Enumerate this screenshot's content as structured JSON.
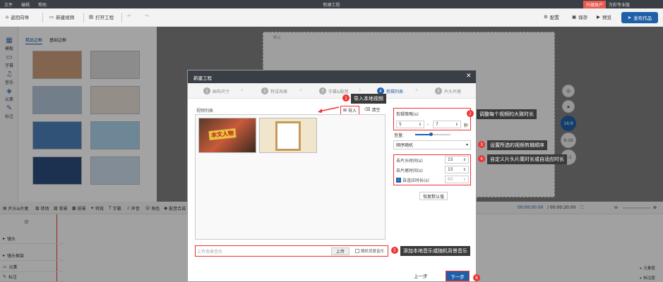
{
  "titlebar": {
    "menu": [
      "文件",
      "编辑",
      "帮助"
    ],
    "window_title": "新建工程",
    "vip": "升级账户",
    "account": "万彩专业版"
  },
  "toolbar": {
    "wizard": "返回向导",
    "new_video": "新建视频",
    "open_project": "打开工程",
    "settings": "配置",
    "save": "保存",
    "preview": "预览",
    "publish": "发布作品"
  },
  "leftnav": {
    "items": [
      "模板",
      "字幕",
      "音乐",
      "元素",
      "标注"
    ]
  },
  "panel": {
    "tab_active": "精品边框",
    "tab_other": "基础边框"
  },
  "canvas": {
    "label": "默认"
  },
  "aspect": [
    "16:9",
    "9:16",
    "1:1"
  ],
  "timeline_toolbar": [
    "片头&片尾",
    "转场",
    "背景",
    "前景",
    "特效",
    "字幕",
    "声音",
    "角色",
    "配音合成"
  ],
  "timeline": {
    "current_time": "00:00:00.00",
    "total_time": "/ 00:00:20.00",
    "tracks": [
      "镜头",
      "镜头框架",
      "元素",
      "标注"
    ],
    "add_element": "+ 元素层",
    "add_note": "+ 标注层"
  },
  "dialog": {
    "title": "新建工程",
    "steps": [
      {
        "num": "1",
        "label": "画布尺寸"
      },
      {
        "num": "2",
        "label": "特设风格"
      },
      {
        "num": "3",
        "label": "字幕&配音"
      },
      {
        "num": "4",
        "label": "剪辑列表"
      },
      {
        "num": "5",
        "label": "片头片尾"
      }
    ],
    "video_list_label": "视频列表",
    "import_label": "导入",
    "clear_label": "清空",
    "thumb1_text": "本文人物",
    "upload_placeholder": "上传背景音乐",
    "upload_button": "上传",
    "random_bgm": "随机背景音乐",
    "clip_strategy_label": "剪辑策略(s)",
    "clip_min": "5",
    "clip_dash": "-",
    "clip_max": "7",
    "clip_unit": "秒",
    "volume_label": "音量:",
    "order_value": "顺序随机",
    "head_time_label": "去片头时间(s)",
    "head_time_value": "15",
    "tail_time_label": "去片尾时间(s)",
    "tail_time_value": "15",
    "adaptive_label": "自适应时长(s)",
    "adaptive_value": "60",
    "reset_button": "恢复默认值",
    "prev_button": "上一步",
    "next_button": "下一步"
  },
  "annotations": [
    {
      "num": "1",
      "text": "导入本地视频"
    },
    {
      "num": "2",
      "text": "调整每个视频的大致时长"
    },
    {
      "num": "3",
      "text": "设置所选的视频剪辑顺序"
    },
    {
      "num": "4",
      "text": "自定义片头片尾时长或自适应时长"
    },
    {
      "num": "5",
      "text": "添加本地音乐或随机背景音乐"
    },
    {
      "num": "6",
      "text": ""
    }
  ],
  "colors": {
    "accent": "#1e5fa8",
    "annotation": "#e33333",
    "titlebar": "#3a3f45"
  }
}
